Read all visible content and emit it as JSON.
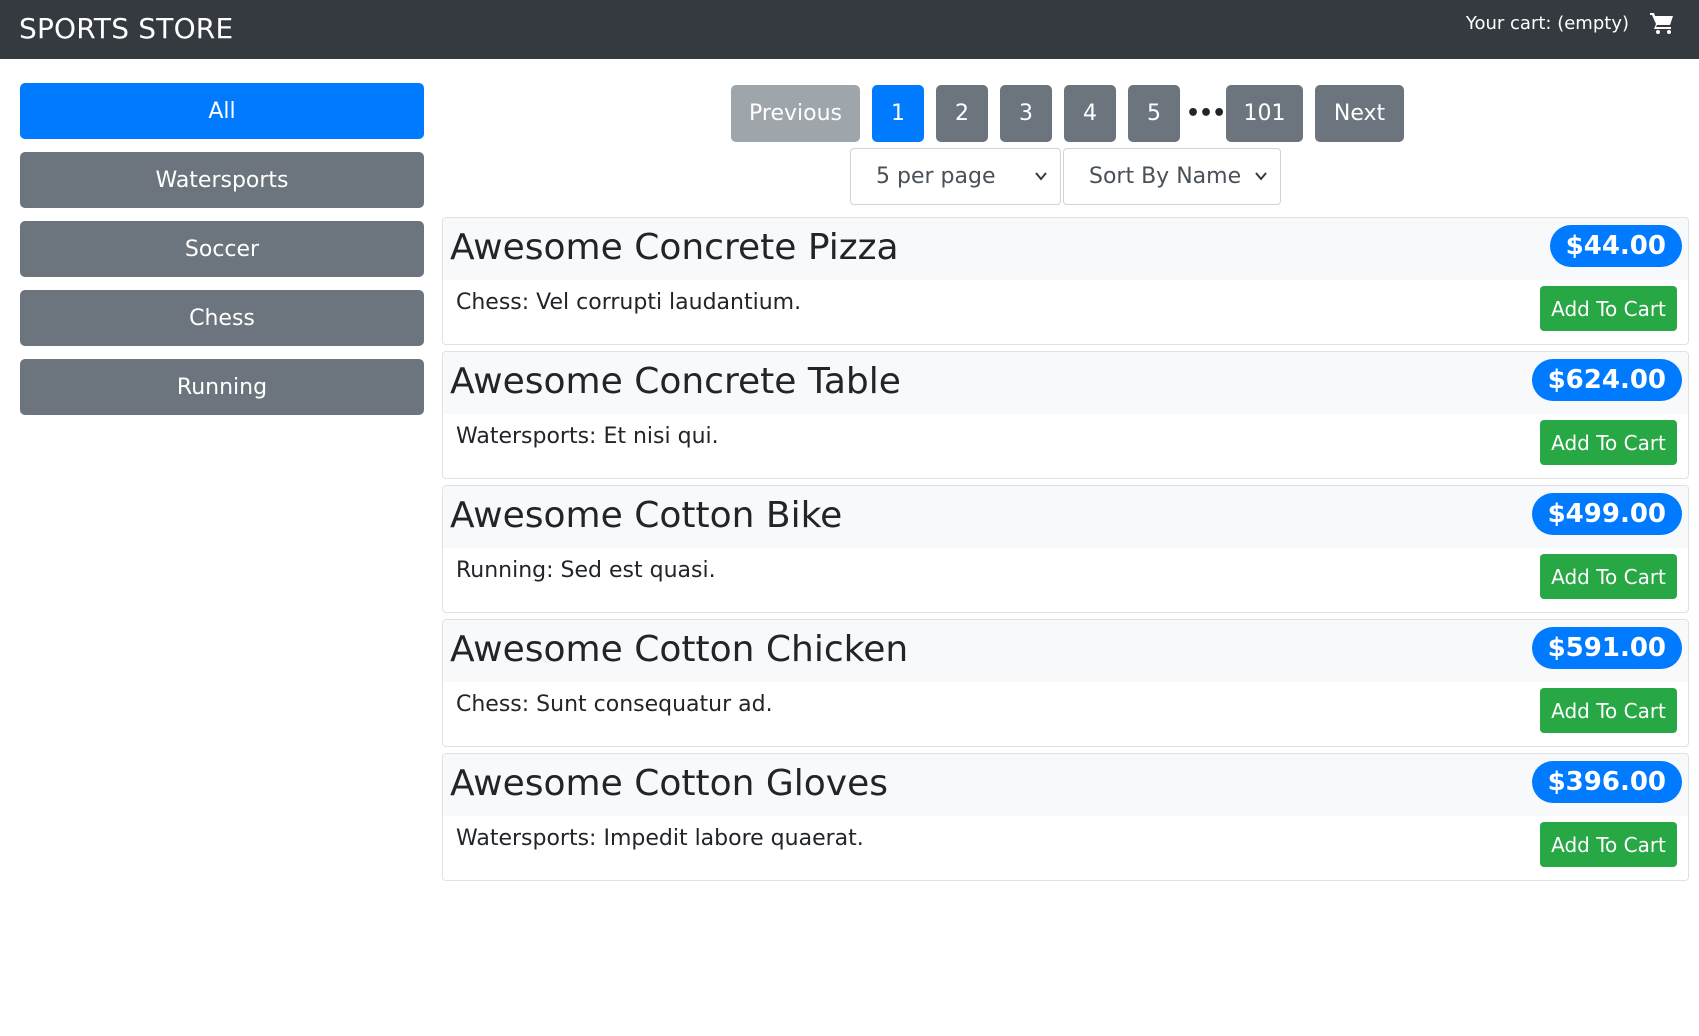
{
  "header": {
    "brand": "SPORTS STORE",
    "cart_label": "Your cart: (empty)",
    "cart_icon": "shopping-cart-icon"
  },
  "sidebar": {
    "categories": [
      {
        "label": "All",
        "active": true
      },
      {
        "label": "Watersports",
        "active": false
      },
      {
        "label": "Soccer",
        "active": false
      },
      {
        "label": "Chess",
        "active": false
      },
      {
        "label": "Running",
        "active": false
      }
    ]
  },
  "pagination": {
    "previous_label": "Previous",
    "pages": [
      "1",
      "2",
      "3",
      "4",
      "5"
    ],
    "current_page": "1",
    "ellipsis": "•••",
    "last_page": "101",
    "next_label": "Next"
  },
  "controls": {
    "per_page_selected": "5 per page",
    "sort_selected": "Sort By Name"
  },
  "products": [
    {
      "name": "Awesome Concrete Pizza",
      "price": "$44.00",
      "description": "Chess: Vel corrupti laudantium.",
      "button": "Add To Cart"
    },
    {
      "name": "Awesome Concrete Table",
      "price": "$624.00",
      "description": "Watersports: Et nisi qui.",
      "button": "Add To Cart"
    },
    {
      "name": "Awesome Cotton Bike",
      "price": "$499.00",
      "description": "Running: Sed est quasi.",
      "button": "Add To Cart"
    },
    {
      "name": "Awesome Cotton Chicken",
      "price": "$591.00",
      "description": "Chess: Sunt consequatur ad.",
      "button": "Add To Cart"
    },
    {
      "name": "Awesome Cotton Gloves",
      "price": "$396.00",
      "description": "Watersports: Impedit labore quaerat.",
      "button": "Add To Cart"
    }
  ],
  "colors": {
    "navbar": "#343a40",
    "primary": "#007bff",
    "secondary": "#6c757d",
    "disabled": "#9ea5ab",
    "success": "#28a745"
  }
}
